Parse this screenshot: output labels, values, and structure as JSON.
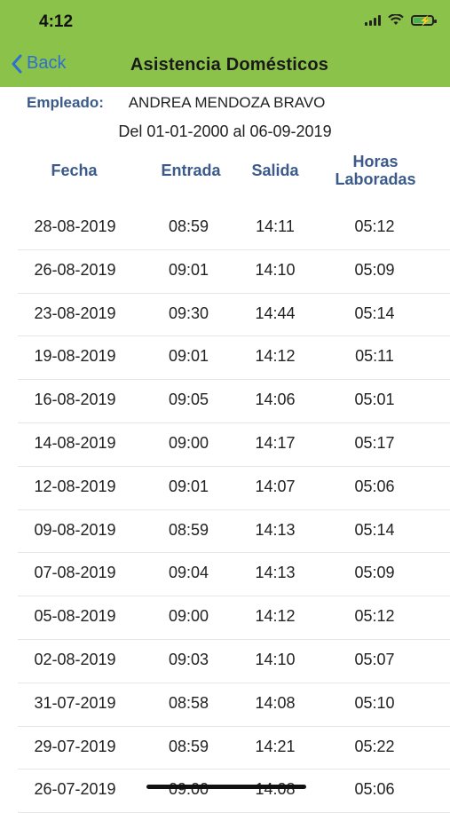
{
  "status": {
    "time": "4:12"
  },
  "nav": {
    "back_label": "Back",
    "title": "Asistencia Domésticos"
  },
  "employee": {
    "label": "Empleado:",
    "name": "ANDREA MENDOZA BRAVO"
  },
  "range": "Del 01-01-2000 al 06-09-2019",
  "columns": {
    "fecha": "Fecha",
    "entrada": "Entrada",
    "salida": "Salida",
    "horas_1": "Horas",
    "horas_2": "Laboradas"
  },
  "rows": [
    {
      "fecha": "28-08-2019",
      "entrada": "08:59",
      "salida": "14:11",
      "horas": "05:12"
    },
    {
      "fecha": "26-08-2019",
      "entrada": "09:01",
      "salida": "14:10",
      "horas": "05:09"
    },
    {
      "fecha": "23-08-2019",
      "entrada": "09:30",
      "salida": "14:44",
      "horas": "05:14"
    },
    {
      "fecha": "19-08-2019",
      "entrada": "09:01",
      "salida": "14:12",
      "horas": "05:11"
    },
    {
      "fecha": "16-08-2019",
      "entrada": "09:05",
      "salida": "14:06",
      "horas": "05:01"
    },
    {
      "fecha": "14-08-2019",
      "entrada": "09:00",
      "salida": "14:17",
      "horas": "05:17"
    },
    {
      "fecha": "12-08-2019",
      "entrada": "09:01",
      "salida": "14:07",
      "horas": "05:06"
    },
    {
      "fecha": "09-08-2019",
      "entrada": "08:59",
      "salida": "14:13",
      "horas": "05:14"
    },
    {
      "fecha": "07-08-2019",
      "entrada": "09:04",
      "salida": "14:13",
      "horas": "05:09"
    },
    {
      "fecha": "05-08-2019",
      "entrada": "09:00",
      "salida": "14:12",
      "horas": "05:12"
    },
    {
      "fecha": "02-08-2019",
      "entrada": "09:03",
      "salida": "14:10",
      "horas": "05:07"
    },
    {
      "fecha": "31-07-2019",
      "entrada": "08:58",
      "salida": "14:08",
      "horas": "05:10"
    },
    {
      "fecha": "29-07-2019",
      "entrada": "08:59",
      "salida": "14:21",
      "horas": "05:22"
    },
    {
      "fecha": "26-07-2019",
      "entrada": "09:00",
      "salida": "14:08",
      "horas": "05:06"
    }
  ]
}
